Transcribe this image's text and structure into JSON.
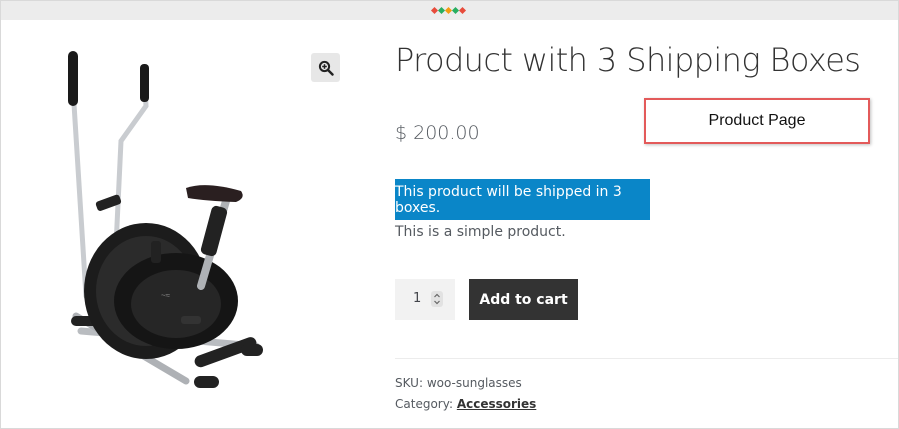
{
  "product": {
    "title": "Product with 3 Shipping Boxes",
    "price": "$ 200.00",
    "shipping_notice": "This product will be shipped in 3 boxes.",
    "description": "This is a simple product.",
    "quantity": "1",
    "add_to_cart_label": "Add to cart",
    "sku_label": "SKU:",
    "sku_value": "woo-sunglasses",
    "category_label": "Category:",
    "category_value": "Accessories"
  },
  "callout": {
    "label": "Product Page"
  },
  "icons": {
    "zoom": "magnifier-plus-icon",
    "quantity_spinner": "up-down-chevron-icon"
  },
  "colors": {
    "notice_bg": "#0a86c8",
    "button_bg": "#333333",
    "callout_border": "#e35a5a",
    "topbar_dots": [
      "#e74c3c",
      "#27ae60",
      "#f39c12",
      "#27ae60",
      "#e74c3c"
    ]
  }
}
